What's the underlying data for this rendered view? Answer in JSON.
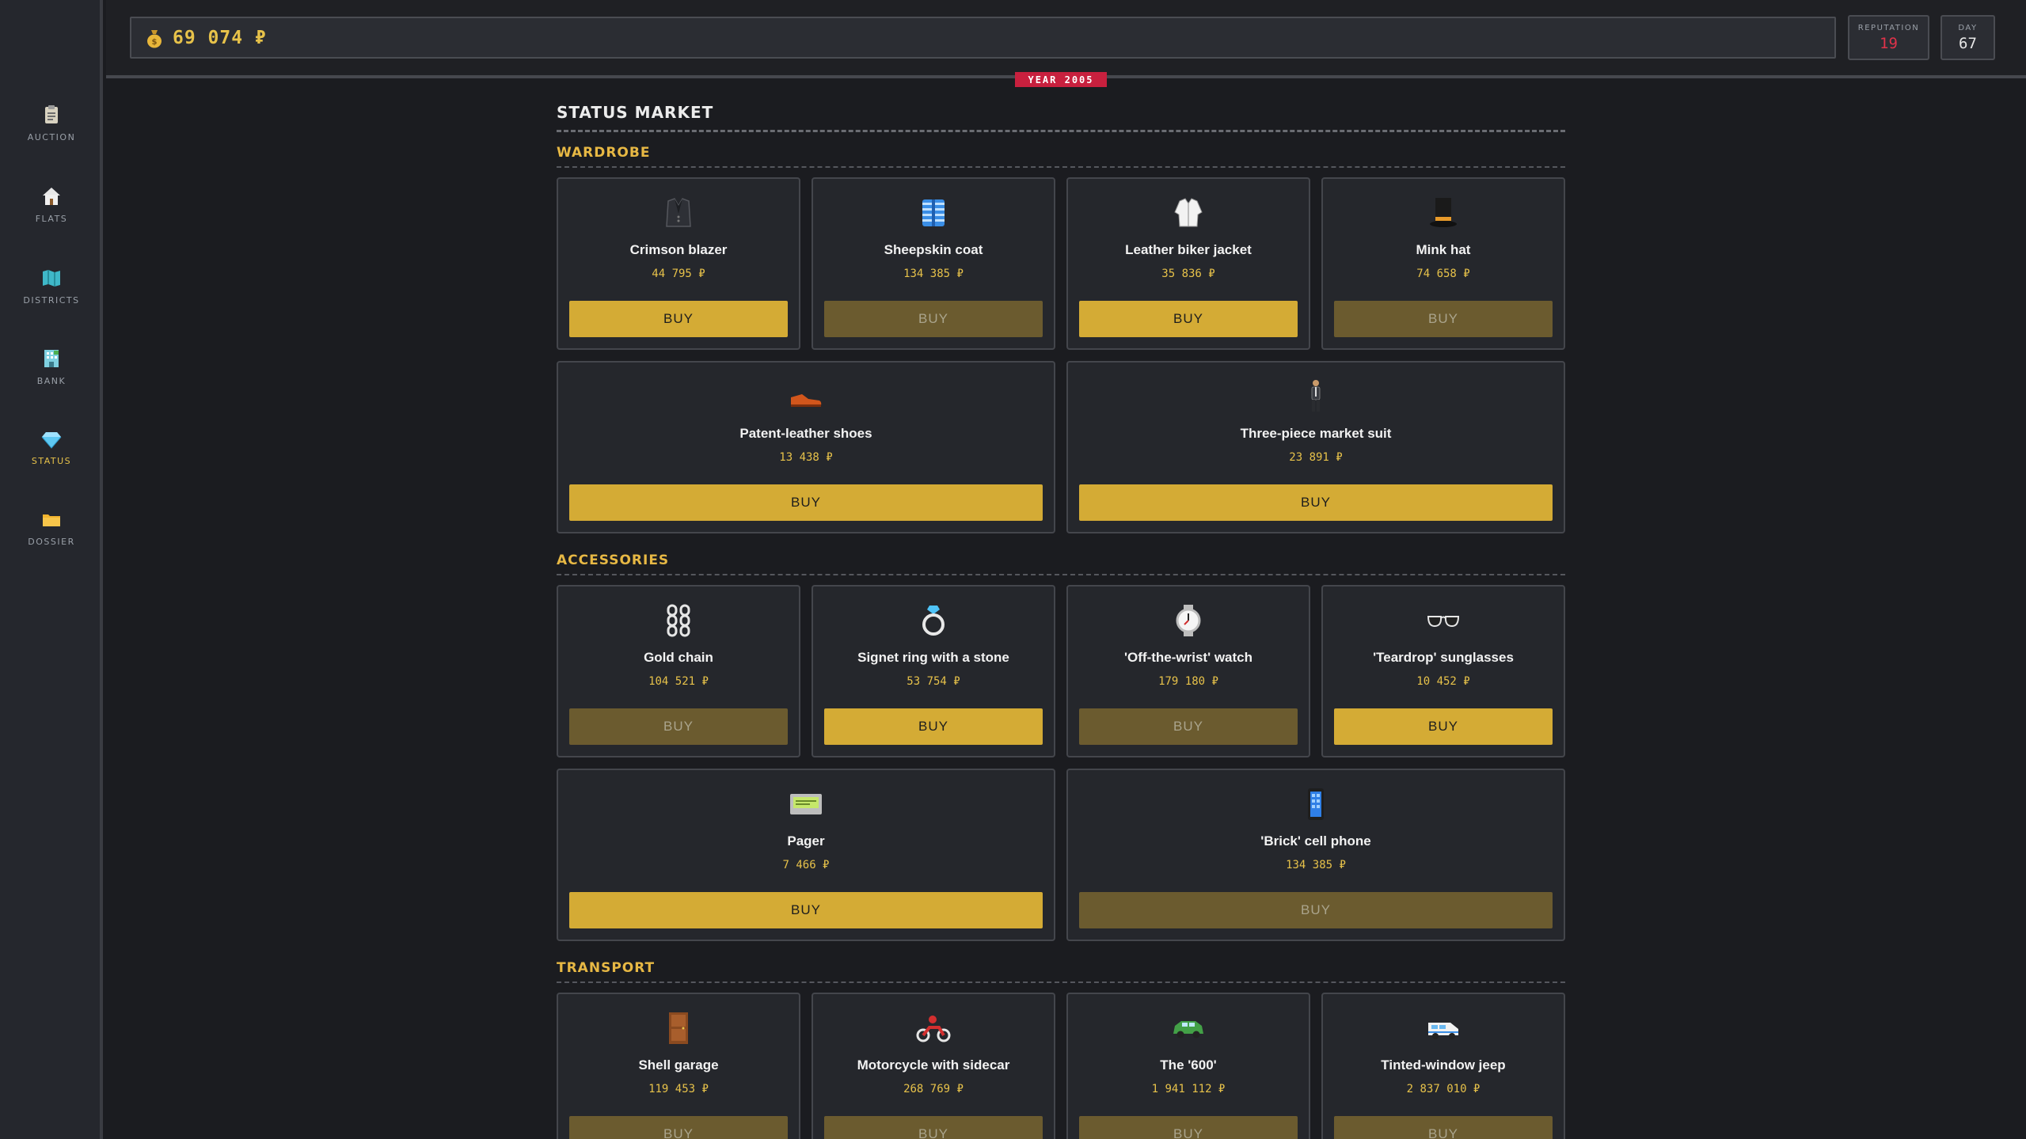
{
  "sidebar": {
    "items": [
      {
        "label": "AUCTION",
        "icon": "clipboard-icon",
        "active": false
      },
      {
        "label": "FLATS",
        "icon": "house-icon",
        "active": false
      },
      {
        "label": "DISTRICTS",
        "icon": "map-icon",
        "active": false
      },
      {
        "label": "BANK",
        "icon": "bank-building-icon",
        "active": false
      },
      {
        "label": "STATUS",
        "icon": "gem-icon",
        "active": true
      },
      {
        "label": "DOSSIER",
        "icon": "folder-icon",
        "active": false
      }
    ]
  },
  "header": {
    "money": "69 074 ₽",
    "money_icon": "money-bag-icon",
    "reputation_label": "REPUTATION",
    "reputation_value": "19",
    "day_label": "DAY",
    "day_value": "67",
    "year_badge": "YEAR 2005"
  },
  "colors": {
    "accent": "#e7c24a",
    "button_active": "#d4ab35",
    "button_disabled": "#6b5b2f",
    "year_badge": "#c8203e",
    "reputation": "#e0334a"
  },
  "page_title": "STATUS MARKET",
  "buy_label": "BUY",
  "sections": {
    "wardrobe": {
      "title": "WARDROBE",
      "items": [
        {
          "name": "Crimson blazer",
          "price": "44 795 ₽",
          "icon": "blazer-icon",
          "affordable": true
        },
        {
          "name": "Sheepskin coat",
          "price": "134 385 ₽",
          "icon": "coat-icon",
          "affordable": false
        },
        {
          "name": "Leather biker jacket",
          "price": "35 836 ₽",
          "icon": "jacket-icon",
          "affordable": true
        },
        {
          "name": "Mink hat",
          "price": "74 658 ₽",
          "icon": "top-hat-icon",
          "affordable": false
        },
        {
          "name": "Patent-leather shoes",
          "price": "13 438 ₽",
          "icon": "shoe-icon",
          "affordable": true
        },
        {
          "name": "Three-piece market suit",
          "price": "23 891 ₽",
          "icon": "suit-person-icon",
          "affordable": true
        }
      ]
    },
    "accessories": {
      "title": "ACCESSORIES",
      "items": [
        {
          "name": "Gold chain",
          "price": "104 521 ₽",
          "icon": "chain-icon",
          "affordable": false
        },
        {
          "name": "Signet ring with a stone",
          "price": "53 754 ₽",
          "icon": "ring-icon",
          "affordable": true
        },
        {
          "name": "'Off-the-wrist' watch",
          "price": "179 180 ₽",
          "icon": "watch-icon",
          "affordable": false
        },
        {
          "name": "'Teardrop' sunglasses",
          "price": "10 452 ₽",
          "icon": "sunglasses-icon",
          "affordable": true
        },
        {
          "name": "Pager",
          "price": "7 466 ₽",
          "icon": "pager-icon",
          "affordable": true
        },
        {
          "name": "'Brick' cell phone",
          "price": "134 385 ₽",
          "icon": "mobile-phone-icon",
          "affordable": false
        }
      ]
    },
    "transport": {
      "title": "TRANSPORT",
      "items": [
        {
          "name": "Shell garage",
          "price": "119 453 ₽",
          "icon": "door-icon",
          "affordable": false
        },
        {
          "name": "Motorcycle with sidecar",
          "price": "268 769 ₽",
          "icon": "motorcycle-icon",
          "affordable": false
        },
        {
          "name": "The '600'",
          "price": "1 941 112 ₽",
          "icon": "car-icon",
          "affordable": false
        },
        {
          "name": "Tinted-window jeep",
          "price": "2 837 010 ₽",
          "icon": "van-icon",
          "affordable": false
        }
      ]
    }
  }
}
